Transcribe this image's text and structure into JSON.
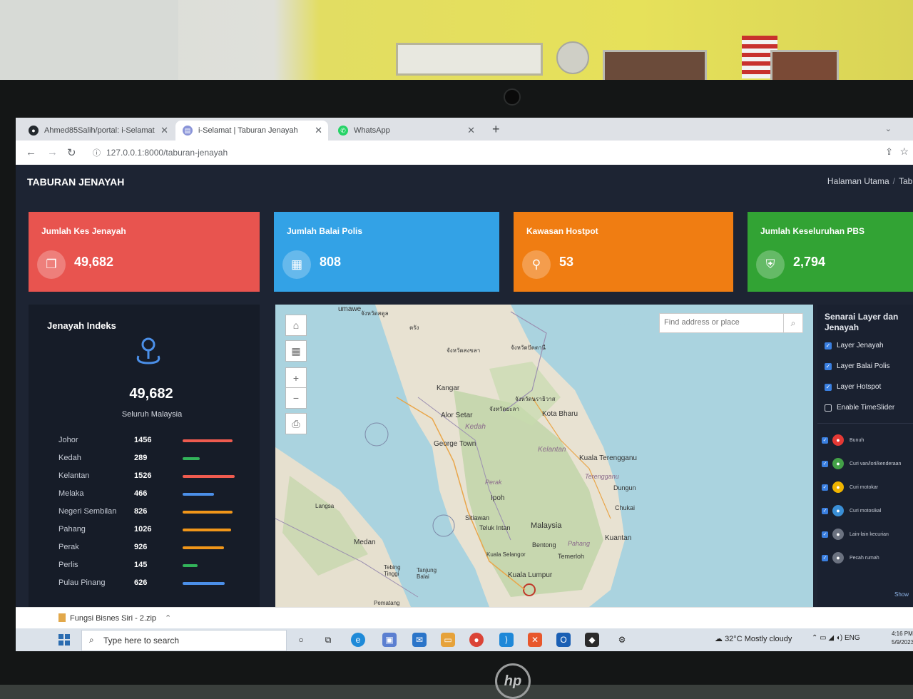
{
  "browser": {
    "tabs": [
      {
        "title": "Ahmed85Salih/portal: i-Selamat",
        "active": false
      },
      {
        "title": "i-Selamat | Taburan Jenayah",
        "active": true
      },
      {
        "title": "WhatsApp",
        "active": false
      }
    ],
    "url": "127.0.0.1:8000/taburan-jenayah"
  },
  "page": {
    "title": "TABURAN JENAYAH",
    "breadcrumb": [
      "Halaman Utama",
      "Tabu"
    ]
  },
  "cards": [
    {
      "label": "Jumlah Kes Jenayah",
      "value": "49,682",
      "color": "#e8544f",
      "icon": "copy-icon"
    },
    {
      "label": "Jumlah Balai Polis",
      "value": "808",
      "color": "#33a2e6",
      "icon": "building-icon"
    },
    {
      "label": "Kawasan Hostpot",
      "value": "53",
      "color": "#f07d12",
      "icon": "map-pin-icon"
    },
    {
      "label": "Jumlah Keseluruhan PBS",
      "value": "2,794",
      "color": "#32a334",
      "icon": "shield-icon"
    }
  ],
  "index_panel": {
    "title": "Jenayah Indeks",
    "total": "49,682",
    "subtitle": "Seluruh Malaysia",
    "states": [
      {
        "name": "Johor",
        "count": "1456",
        "color": "#ef5b4f",
        "fraction": 0.95
      },
      {
        "name": "Kedah",
        "count": "289",
        "color": "#32b35a",
        "fraction": 0.33
      },
      {
        "name": "Kelantan",
        "count": "1526",
        "color": "#ef5b4f",
        "fraction": 0.98
      },
      {
        "name": "Melaka",
        "count": "466",
        "color": "#4b8fe8",
        "fraction": 0.6
      },
      {
        "name": "Negeri Sembilan",
        "count": "826",
        "color": "#f0961a",
        "fraction": 0.95
      },
      {
        "name": "Pahang",
        "count": "1026",
        "color": "#f0961a",
        "fraction": 0.92
      },
      {
        "name": "Perak",
        "count": "926",
        "color": "#f0961a",
        "fraction": 0.78
      },
      {
        "name": "Perlis",
        "count": "145",
        "color": "#32b35a",
        "fraction": 0.28
      },
      {
        "name": "Pulau Pinang",
        "count": "626",
        "color": "#4b8fe8",
        "fraction": 0.8
      }
    ]
  },
  "map": {
    "search_placeholder": "Find address or place",
    "places": [
      {
        "name": "Kangar"
      },
      {
        "name": "Alor Setar"
      },
      {
        "name": "Kedah"
      },
      {
        "name": "George Town"
      },
      {
        "name": "Kota Bharu"
      },
      {
        "name": "Kelantan"
      },
      {
        "name": "Kuala Terengganu"
      },
      {
        "name": "Terengganu"
      },
      {
        "name": "Dungun"
      },
      {
        "name": "Chukai"
      },
      {
        "name": "Perak"
      },
      {
        "name": "Ipoh"
      },
      {
        "name": "Sitiawan"
      },
      {
        "name": "Teluk Intan"
      },
      {
        "name": "Malaysia"
      },
      {
        "name": "Bentong"
      },
      {
        "name": "Pahang"
      },
      {
        "name": "Kuantan"
      },
      {
        "name": "Temerloh"
      },
      {
        "name": "Kuala Selangor"
      },
      {
        "name": "Kuala Lumpur"
      },
      {
        "name": "Medan"
      },
      {
        "name": "Langsa"
      },
      {
        "name": "Tebing Tinggi"
      },
      {
        "name": "Tanjung Balai"
      },
      {
        "name": "Pematang"
      },
      {
        "name": "umawe"
      },
      {
        "name": "จังหวัดสงขลา"
      },
      {
        "name": "จังหวัดนราธิวาส"
      },
      {
        "name": "จังหวัดยะลา"
      },
      {
        "name": "จังหวัดปัตตานี"
      },
      {
        "name": "จังหวัดสตูล"
      },
      {
        "name": "ตรัง"
      }
    ]
  },
  "layers": {
    "title": "Senarai Layer dan Jenayah",
    "toggles": [
      {
        "label": "Layer Jenayah",
        "checked": true
      },
      {
        "label": "Layer Balai Polis",
        "checked": true
      },
      {
        "label": "Layer Hotspot",
        "checked": true
      },
      {
        "label": "Enable TimeSlider",
        "checked": false
      }
    ],
    "legend": [
      {
        "label": "Bunuh",
        "color": "#e53935",
        "icon": "target-icon"
      },
      {
        "label": "Curi van/lori/kenderaan",
        "color": "#43a047",
        "icon": "truck-icon"
      },
      {
        "label": "Curi motokar",
        "color": "#f0b400",
        "icon": "car-icon"
      },
      {
        "label": "Curi motosikal",
        "color": "#3a8fd6",
        "icon": "motorcycle-icon"
      },
      {
        "label": "Lain-lain kecurian",
        "color": "#6b7280",
        "icon": "hand-icon"
      },
      {
        "label": "Pecah rumah",
        "color": "#6b7280",
        "icon": "house-icon"
      }
    ],
    "show_label": "Show"
  },
  "download": {
    "file": "Fungsi Bisnes Siri - 2.zip"
  },
  "taskbar": {
    "search_placeholder": "Type here to search",
    "weather": "32°C  Mostly cloudy",
    "lang": "ENG",
    "time": "4:16 PM",
    "date": "5/9/2023"
  }
}
